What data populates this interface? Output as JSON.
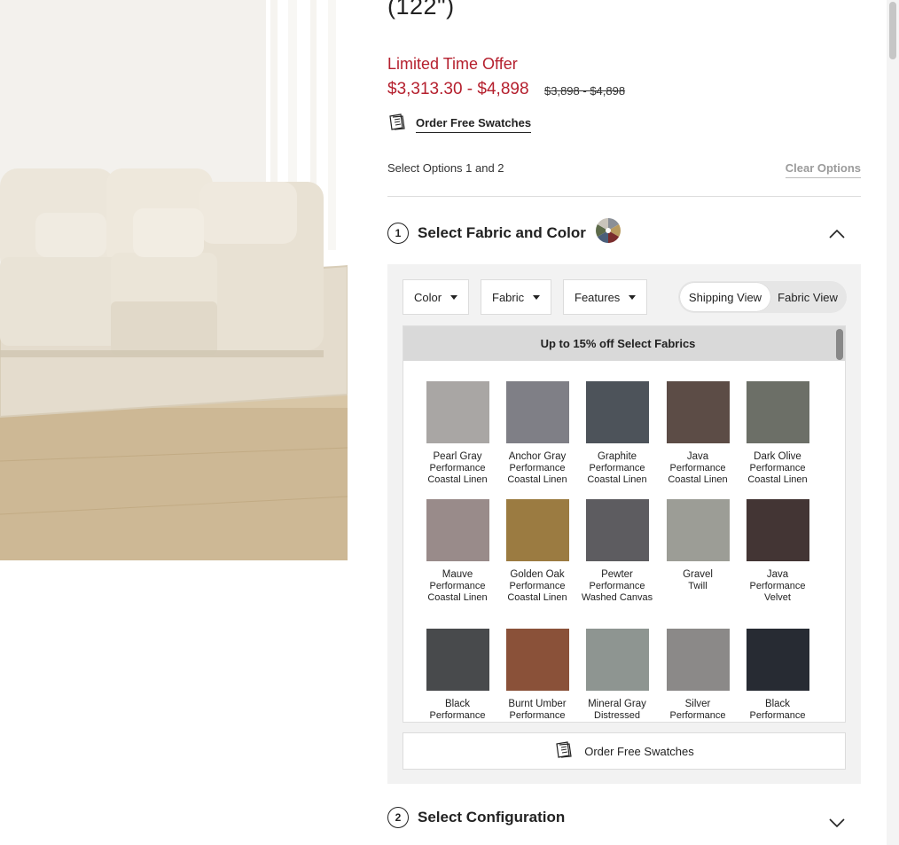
{
  "product": {
    "title": "(122\")",
    "offer_label": "Limited Time Offer",
    "price_range": "$3,313.30 - $4,898",
    "original_price_range": "$3,898 - $4,898",
    "order_swatches_link": "Order Free Swatches",
    "select_options_text": "Select Options 1 and 2",
    "clear_options_label": "Clear Options",
    "image_icon": "sectional-sofa-photo"
  },
  "step1": {
    "number": "1",
    "title": "Select Fabric and Color",
    "icon": "color-wheel-icon",
    "state": "expanded",
    "filters": {
      "color": "Color",
      "fabric": "Fabric",
      "features": "Features"
    },
    "view_toggle": {
      "shipping": "Shipping View",
      "fabric": "Fabric View",
      "selected": "Shipping View"
    },
    "promo_banner": "Up to 15% off Select Fabrics",
    "swatches": [
      {
        "name": "Pearl Gray",
        "desc": "Performance Coastal Linen",
        "color": "#a9a6a4"
      },
      {
        "name": "Anchor Gray",
        "desc": "Performance Coastal Linen",
        "color": "#7f7f86"
      },
      {
        "name": "Graphite",
        "desc": "Performance Coastal Linen",
        "color": "#4d535a"
      },
      {
        "name": "Java",
        "desc": "Performance Coastal Linen",
        "color": "#5c4c46"
      },
      {
        "name": "Dark Olive",
        "desc": "Performance Coastal Linen",
        "color": "#6c6f67"
      },
      {
        "name": "Mauve",
        "desc": "Performance Coastal Linen",
        "color": "#998b8a"
      },
      {
        "name": "Golden Oak",
        "desc": "Performance Coastal Linen",
        "color": "#9b7b41"
      },
      {
        "name": "Pewter",
        "desc": "Performance Washed Canvas",
        "color": "#5d5c60"
      },
      {
        "name": "Gravel",
        "desc": "Twill",
        "color": "#9c9d96"
      },
      {
        "name": "Java",
        "desc": "Performance Velvet",
        "color": "#433534"
      },
      {
        "name": "Black",
        "desc": "Performance",
        "color": "#484a4c"
      },
      {
        "name": "Burnt Umber",
        "desc": "Performance",
        "color": "#8a5139"
      },
      {
        "name": "Mineral Gray",
        "desc": "Distressed",
        "color": "#8e9591"
      },
      {
        "name": "Silver",
        "desc": "Performance",
        "color": "#8b8988"
      },
      {
        "name": "Black",
        "desc": "Performance",
        "color": "#272b33"
      }
    ],
    "order_swatches_button": "Order Free Swatches"
  },
  "step2": {
    "number": "2",
    "title": "Select Configuration",
    "state": "collapsed"
  },
  "colors": {
    "sale_red": "#b5202e",
    "panel_gray": "#f2f2f2"
  }
}
